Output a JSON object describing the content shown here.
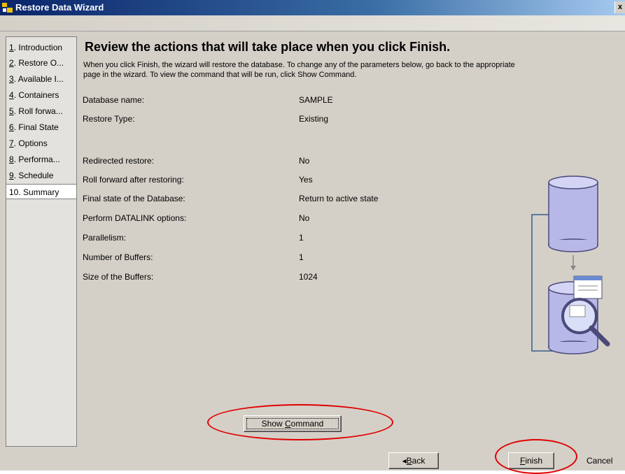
{
  "window": {
    "title": "Restore Data Wizard",
    "close_label": "x"
  },
  "nav": {
    "items": [
      {
        "num": "1",
        "label": ". Introduction"
      },
      {
        "num": "2",
        "label": ". Restore O..."
      },
      {
        "num": "3",
        "label": ". Available I..."
      },
      {
        "num": "4",
        "label": ". Containers"
      },
      {
        "num": "5",
        "label": ". Roll forwa..."
      },
      {
        "num": "6",
        "label": ". Final State"
      },
      {
        "num": "7",
        "label": ". Options"
      },
      {
        "num": "8",
        "label": ". Performa..."
      },
      {
        "num": "9",
        "label": ". Schedule"
      },
      {
        "num": "",
        "label": "10. Summary"
      }
    ],
    "active_index": 9
  },
  "summary": {
    "heading": "Review the actions that will take place when you click Finish.",
    "description_line1": "When you click Finish, the wizard will restore the database. To change any of the parameters below, go back to the appropriate",
    "description_line2": "page in the wizard. To view the command that will be run, click Show Command.",
    "rows": [
      {
        "label": "Database name:",
        "value": "SAMPLE"
      },
      {
        "label": "Restore Type:",
        "value": "Existing"
      },
      {
        "label": "Redirected restore:",
        "value": "No"
      },
      {
        "label": "Roll forward after restoring:",
        "value": "Yes"
      },
      {
        "label": "Final state of the Database:",
        "value": "Return to active state"
      },
      {
        "label": "Perform DATALINK options:",
        "value": "No"
      },
      {
        "label": "Parallelism:",
        "value": "1"
      },
      {
        "label": "Number of Buffers:",
        "value": "1"
      },
      {
        "label": "Size of the Buffers:",
        "value": "1024"
      }
    ]
  },
  "buttons": {
    "show_command_pre": "Show ",
    "show_command_u": "C",
    "show_command_post": "ommand",
    "back_arrow": "◂",
    "back_u": "B",
    "back_post": "ack",
    "finish_u": "F",
    "finish_post": "inish",
    "cancel": "Cancel"
  },
  "colors": {
    "highlight_oval": "#e00000",
    "titlebar": "#0a246a",
    "cylinder_fill": "#b8b8e8"
  },
  "illustration": "database-restore-icon"
}
